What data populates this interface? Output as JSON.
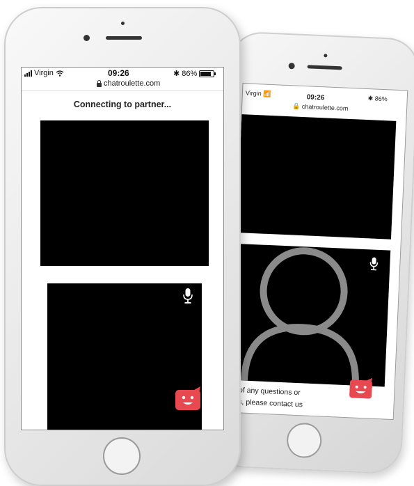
{
  "status_bar": {
    "carrier": "Virgin",
    "time": "09:26",
    "battery": "86%",
    "url": "chatroulette.com"
  },
  "front_screen": {
    "status_text": "Connecting to partner..."
  },
  "back_screen": {
    "footer_line1": "e of any questions or",
    "footer_line2": "ms, please contact us"
  },
  "colors": {
    "bubble": "#e8484f",
    "video_bg": "#000000",
    "avatar_gray": "#8a8a8a"
  },
  "icons": [
    "microphone-icon",
    "chat-bubble-icon",
    "lock-icon",
    "wifi-icon",
    "bluetooth-icon",
    "battery-icon",
    "signal-icon",
    "avatar-silhouette"
  ]
}
